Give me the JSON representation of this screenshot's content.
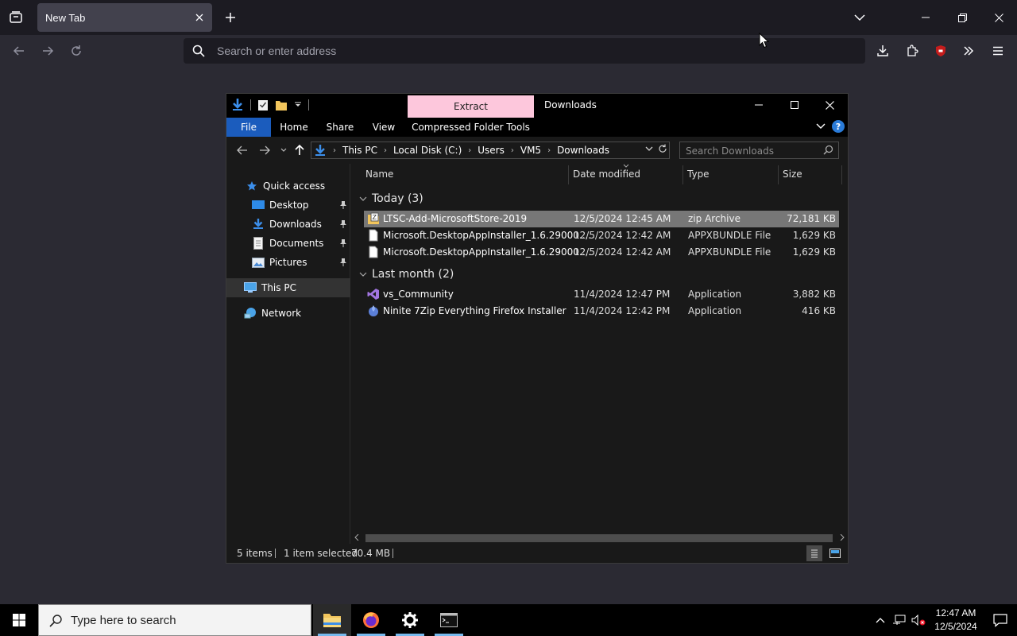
{
  "browser": {
    "tab_title": "New Tab",
    "url_placeholder": "Search or enter address"
  },
  "explorer": {
    "title": "Downloads",
    "contextual_tab": "Extract",
    "ribbon_tabs": [
      "File",
      "Home",
      "Share",
      "View",
      "Compressed Folder Tools"
    ],
    "breadcrumb": [
      "This PC",
      "Local Disk (C:)",
      "Users",
      "VM5",
      "Downloads"
    ],
    "search_placeholder": "Search Downloads",
    "help_label": "?",
    "nav": {
      "quick_access": "Quick access",
      "items": [
        "Desktop",
        "Downloads",
        "Documents",
        "Pictures"
      ],
      "this_pc": "This PC",
      "network": "Network"
    },
    "columns": {
      "name": "Name",
      "date": "Date modified",
      "type": "Type",
      "size": "Size"
    },
    "groups": [
      {
        "label": "Today (3)",
        "files": [
          {
            "name": "LTSC-Add-MicrosoftStore-2019",
            "date": "12/5/2024 12:45 AM",
            "type": "zip Archive",
            "size": "72,181 KB",
            "icon": "zip-icon",
            "selected": true
          },
          {
            "name": "Microsoft.DesktopAppInstaller_1.6.29000....",
            "date": "12/5/2024 12:42 AM",
            "type": "APPXBUNDLE File",
            "size": "1,629 KB",
            "icon": "file-icon",
            "selected": false
          },
          {
            "name": "Microsoft.DesktopAppInstaller_1.6.29000....",
            "date": "12/5/2024 12:42 AM",
            "type": "APPXBUNDLE File",
            "size": "1,629 KB",
            "icon": "file-icon",
            "selected": false
          }
        ]
      },
      {
        "label": "Last month (2)",
        "files": [
          {
            "name": "vs_Community",
            "date": "11/4/2024 12:47 PM",
            "type": "Application",
            "size": "3,882 KB",
            "icon": "visual-studio-icon",
            "selected": false
          },
          {
            "name": "Ninite 7Zip Everything Firefox Installer",
            "date": "11/4/2024 12:42 PM",
            "type": "Application",
            "size": "416 KB",
            "icon": "ninite-icon",
            "selected": false
          }
        ]
      }
    ],
    "status": {
      "items": "5 items",
      "selected": "1 item selected",
      "size": "70.4 MB"
    }
  },
  "taskbar": {
    "search_placeholder": "Type here to search",
    "time": "12:47 AM",
    "date": "12/5/2024"
  },
  "colors": {
    "accent": "#1b5cbd",
    "extract_tab": "#fdc7dc",
    "selection": "#777777"
  }
}
